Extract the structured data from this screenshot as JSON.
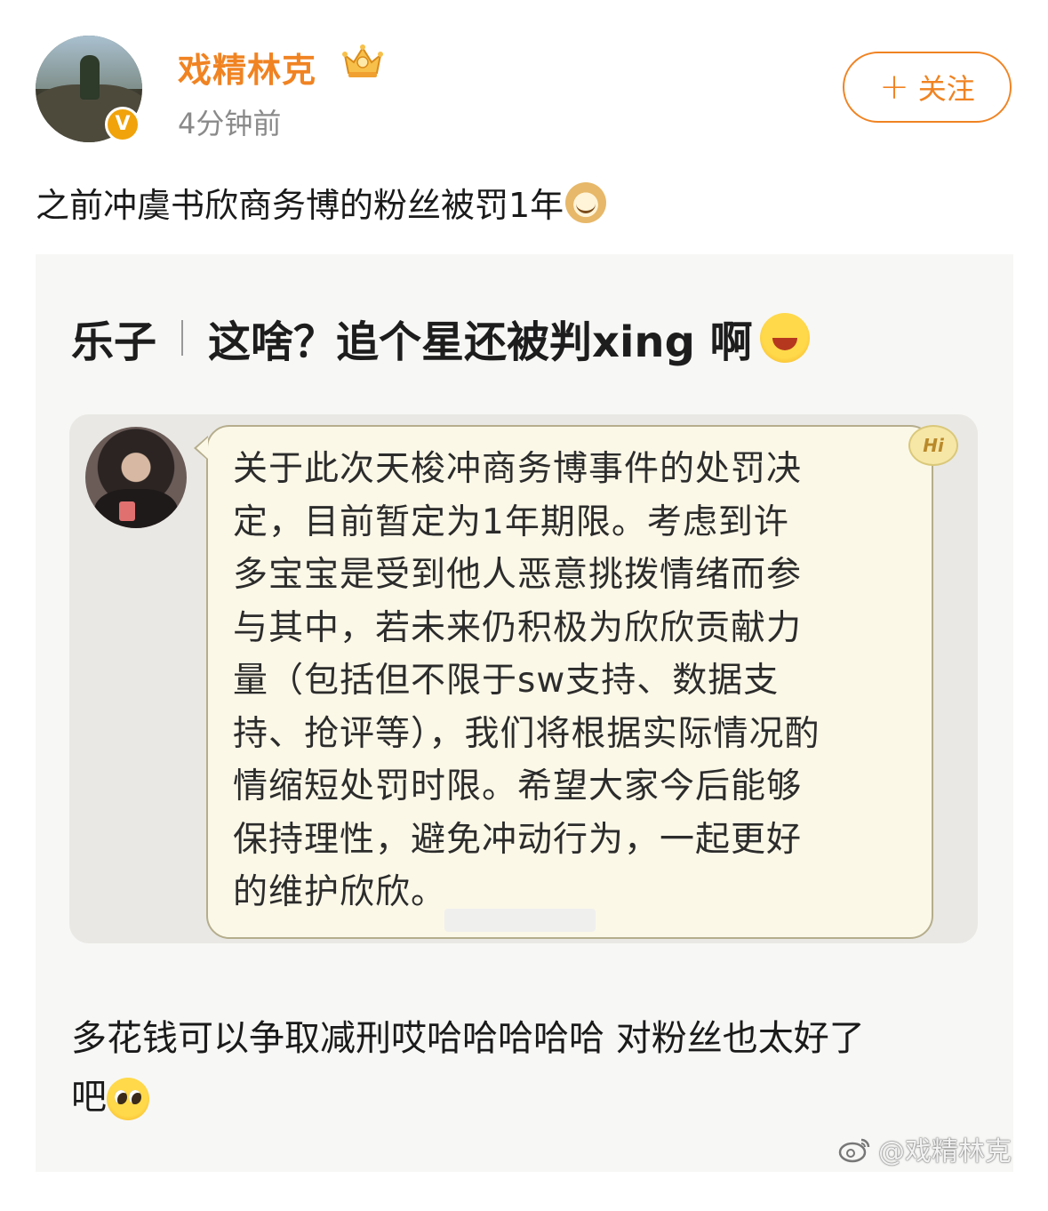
{
  "post": {
    "author": "戏精林克",
    "timestamp": "4分钟前",
    "verified_badge": "V",
    "follow_label": "关注",
    "follow_icon": "+",
    "text": "之前冲虞书欣商务博的粉丝被罚1年",
    "text_emoji": "doge-emoji"
  },
  "embedded_image": {
    "title_prefix": "乐子",
    "title": "这啥？追个星还被判xing 啊",
    "title_emoji": "laugh-crying-emoji",
    "hi_badge": "Hi",
    "message": "关于此次天梭冲商务博事件的处罚决\n定，目前暂定为1年期限。考虑到许\n多宝宝是受到他人恶意挑拨情绪而参\n与其中，若未来仍积极为欣欣贡献力\n量（包括但不限于sw支持、数据支\n持、抢评等），我们将根据实际情况酌\n情缩短处罚时限。希望大家今后能够\n保持理性，避免冲动行为，一起更好\n的维护欣欣。",
    "caption_line1": "多花钱可以争取减刑哎哈哈哈哈哈 对粉丝也太好了",
    "caption_line2": "吧",
    "caption_emoji": "pleading-emoji"
  },
  "watermark": {
    "text": "@戏精林克",
    "icon": "weibo-logo-icon"
  },
  "colors": {
    "accent": "#f08322",
    "verified": "#f0a30a",
    "bubble_bg": "#fbf8e8",
    "panel_bg": "#e9e8e4"
  }
}
